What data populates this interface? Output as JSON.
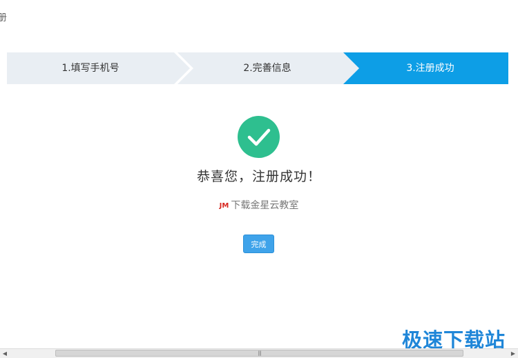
{
  "corner_char": "册",
  "steps": [
    {
      "label": "1.填写手机号",
      "active": false
    },
    {
      "label": "2.完善信息",
      "active": false
    },
    {
      "label": "3.注册成功",
      "active": true
    }
  ],
  "colors": {
    "step_inactive": "#e9eef3",
    "step_active": "#0d9ee6",
    "success": "#2ebf8f",
    "button": "#3fa3ea",
    "watermark": "#1f86d8"
  },
  "success": {
    "icon": "check-circle-icon",
    "headline": "恭喜您，注册成功！",
    "brand_mark": "JM",
    "subtext": "下载金星云教室"
  },
  "actions": {
    "done_label": "完成"
  },
  "watermark": "极速下载站",
  "scrollbar": {
    "left_arrow": "◀",
    "right_arrow": "▶",
    "grip": "|||"
  }
}
